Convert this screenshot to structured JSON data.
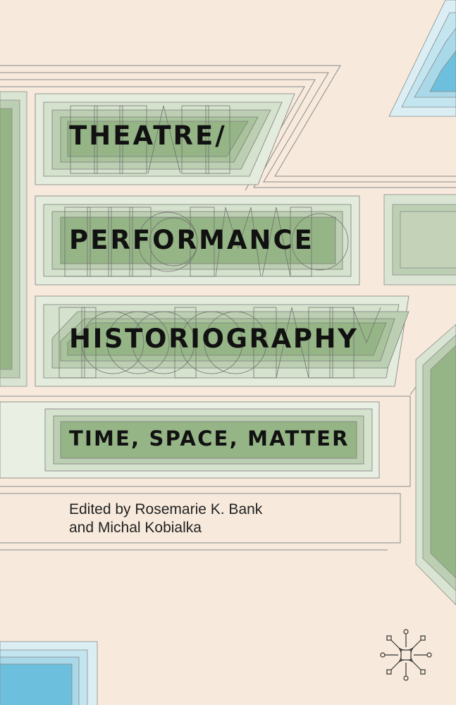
{
  "book": {
    "title_lines": [
      "THEATRE/",
      "PERFORMANCE",
      "HISTORIOGRAPHY"
    ],
    "subtitle": "TIME, SPACE, MATTER",
    "editor_lines": [
      "Edited by Rosemarie K. Bank",
      "and Michal Kobialka"
    ]
  },
  "colors": {
    "background": "#f7eadc",
    "green_light": "#d9e5d2",
    "green_mid": "#bccfb2",
    "green_dark": "#96b587",
    "blue_light": "#dbeef4",
    "blue_mid": "#a9d8e8",
    "blue_dark": "#6cc0dd",
    "outline": "#7d7d7d"
  },
  "icons": [
    "publisher-logo-icon"
  ]
}
